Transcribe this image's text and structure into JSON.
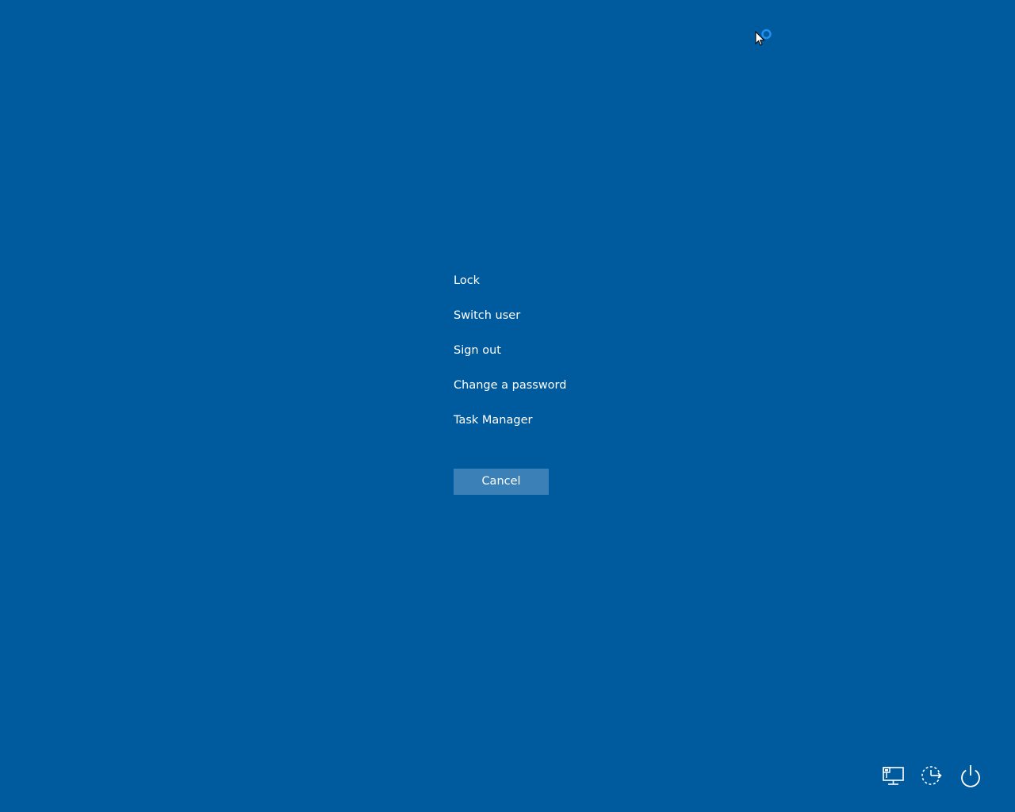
{
  "background_color": "#005a9e",
  "menu": {
    "items": [
      {
        "name": "lock",
        "label": "Lock"
      },
      {
        "name": "switch-user",
        "label": "Switch user"
      },
      {
        "name": "sign-out",
        "label": "Sign out"
      },
      {
        "name": "change-password",
        "label": "Change a password"
      },
      {
        "name": "task-manager",
        "label": "Task Manager"
      }
    ]
  },
  "cancel": {
    "label": "Cancel",
    "color": "#3b80b7"
  },
  "tray": {
    "icons": [
      "network-icon",
      "ease-of-access-icon",
      "power-icon"
    ]
  },
  "cursor": {
    "icon": "busy-cursor-icon"
  }
}
